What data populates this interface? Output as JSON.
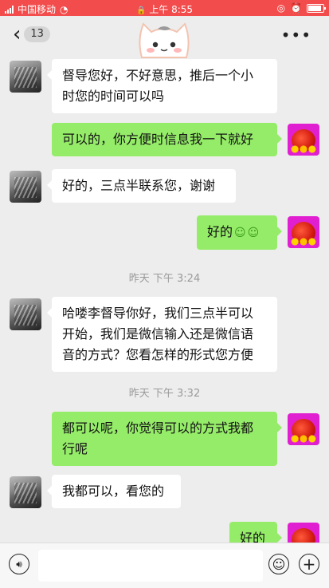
{
  "status_bar": {
    "carrier": "中国移动",
    "time": "上午 8:55"
  },
  "header": {
    "back_count": "13",
    "more": "•••"
  },
  "colors": {
    "status_bar": "#f24c4c",
    "background": "#ededed",
    "bubble_out": "#95ec69",
    "bubble_in": "#ffffff"
  },
  "messages": [
    {
      "side": "in",
      "text_lines": [
        "督导您好，不好意思，推后一个小",
        "时您的时间可以吗"
      ]
    },
    {
      "side": "out",
      "text": "可以的，你方便时信息我一下就好"
    },
    {
      "side": "in",
      "text": "好的，三点半联系您，谢谢"
    },
    {
      "side": "out",
      "text": "好的",
      "emoji": "smile-emoji x2"
    },
    {
      "side": "time",
      "text": "昨天 下午 3:24"
    },
    {
      "side": "in",
      "text_lines": [
        "哈喽李督导你好，我们三点半可以",
        "开始，我们是微信输入还是微信语",
        "音的方式？您看怎样的形式您方便"
      ]
    },
    {
      "side": "time",
      "text": "昨天 下午 3:32"
    },
    {
      "side": "out",
      "text_lines": [
        "都可以呢，你觉得可以的方式我都",
        "行呢"
      ]
    },
    {
      "side": "in",
      "text": "我都可以，看您的"
    },
    {
      "side": "out",
      "text": "好的"
    }
  ],
  "input_bar": {
    "voice_icon": "voice-icon",
    "emoji_icon": "emoji-icon",
    "plus_icon": "plus-icon"
  }
}
